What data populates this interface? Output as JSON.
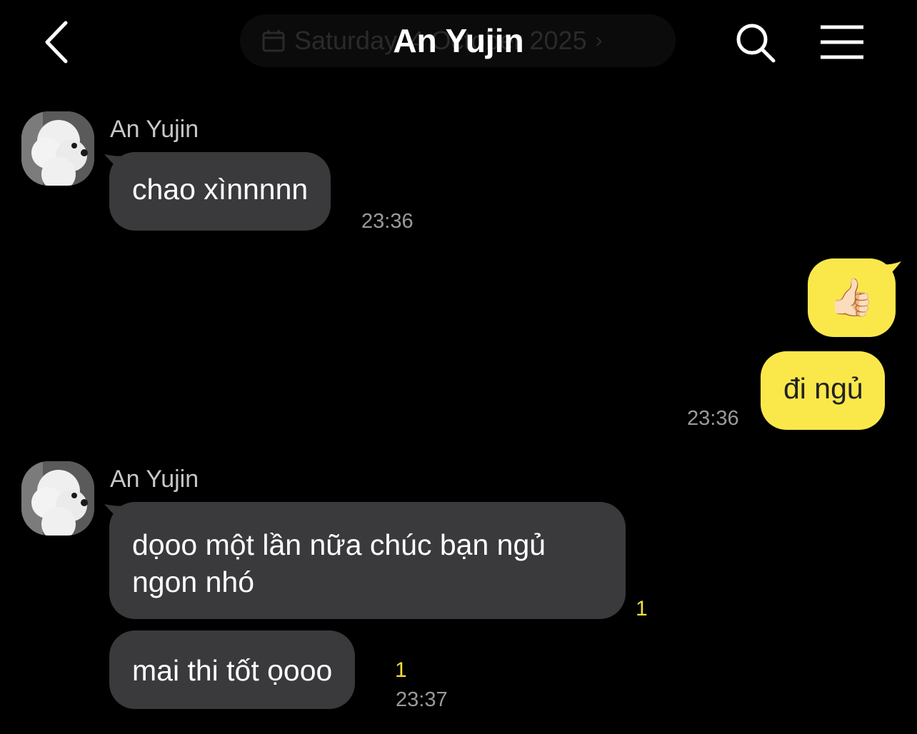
{
  "header": {
    "title": "An Yujin",
    "date_pill": "Saturday, 4 October 2025"
  },
  "messages": [
    {
      "sender": "An Yujin",
      "text": "chao xìnnnnn",
      "time": "23:36"
    },
    {
      "emoji": "👍🏻"
    },
    {
      "text": "đi ngủ",
      "time": "23:36"
    },
    {
      "sender": "An Yujin",
      "text_line1": "dọoo một lần nữa chúc bạn ngủ",
      "text_line2": "ngon nhó",
      "unread": "1"
    },
    {
      "text": "mai thi tốt ọooo",
      "unread": "1",
      "time": "23:37"
    }
  ],
  "colors": {
    "incoming_bubble": "#3a3a3c",
    "outgoing_bubble": "#fae84b",
    "unread_count": "#f5df3c",
    "background": "#000000"
  },
  "icons": [
    "back-chevron-icon",
    "calendar-icon",
    "search-icon",
    "menu-icon",
    "avatar"
  ]
}
